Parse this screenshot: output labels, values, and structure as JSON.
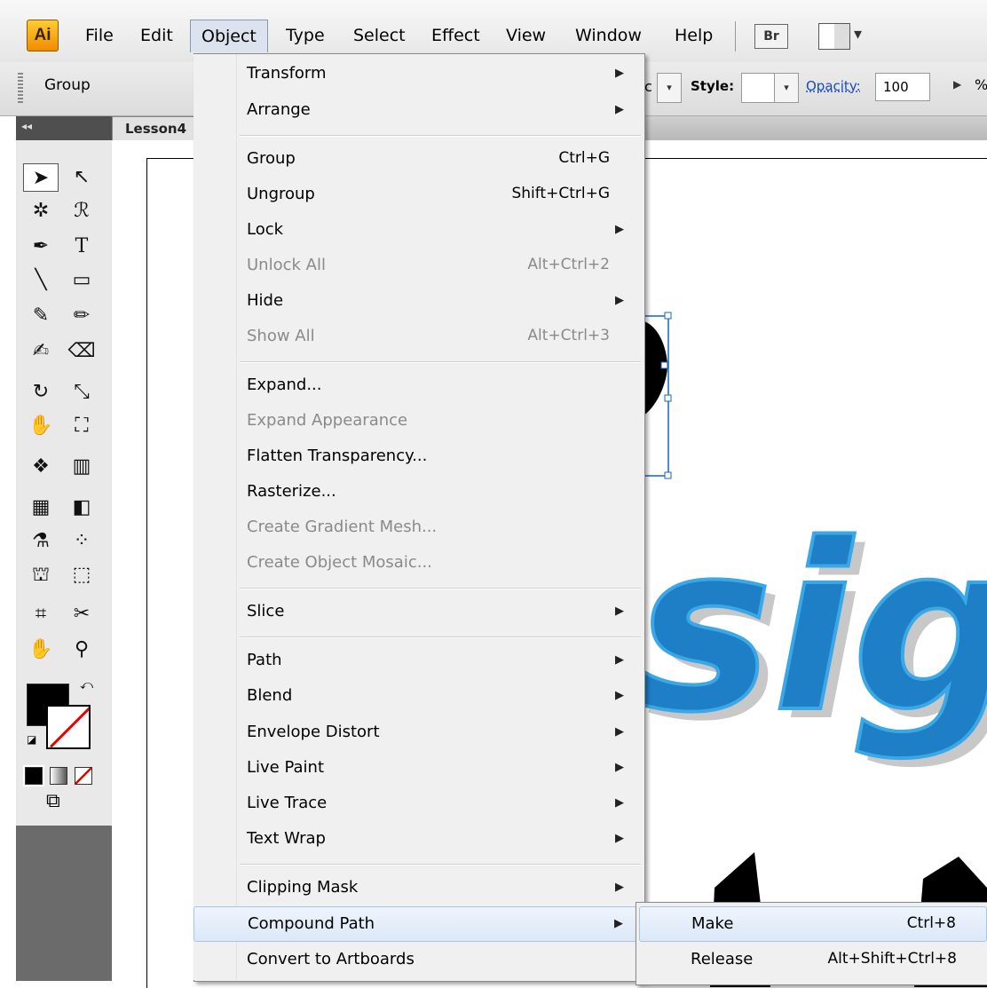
{
  "app": {
    "logo": "Ai"
  },
  "menubar": {
    "items": [
      "File",
      "Edit",
      "Object",
      "Type",
      "Select",
      "Effect",
      "View",
      "Window",
      "Help"
    ],
    "bridge_label": "Br"
  },
  "controlbar": {
    "selection_label": "Group",
    "partial_text": "c",
    "style_label": "Style:",
    "opacity_label": "Opacity:",
    "opacity_value": "100",
    "opacity_unit": "%"
  },
  "tools": {
    "collapse": "◂◂"
  },
  "document": {
    "tab_label": "Lesson4"
  },
  "object_menu": {
    "items": [
      {
        "label": "Transform",
        "shortcut": "",
        "submenu": true,
        "enabled": true
      },
      {
        "label": "Arrange",
        "shortcut": "",
        "submenu": true,
        "enabled": true
      },
      {
        "label": "Group",
        "shortcut": "Ctrl+G",
        "submenu": false,
        "enabled": true
      },
      {
        "label": "Ungroup",
        "shortcut": "Shift+Ctrl+G",
        "submenu": false,
        "enabled": true
      },
      {
        "label": "Lock",
        "shortcut": "",
        "submenu": true,
        "enabled": true
      },
      {
        "label": "Unlock All",
        "shortcut": "Alt+Ctrl+2",
        "submenu": false,
        "enabled": false
      },
      {
        "label": "Hide",
        "shortcut": "",
        "submenu": true,
        "enabled": true
      },
      {
        "label": "Show All",
        "shortcut": "Alt+Ctrl+3",
        "submenu": false,
        "enabled": false
      },
      {
        "label": "Expand...",
        "shortcut": "",
        "submenu": false,
        "enabled": true
      },
      {
        "label": "Expand Appearance",
        "shortcut": "",
        "submenu": false,
        "enabled": false
      },
      {
        "label": "Flatten Transparency...",
        "shortcut": "",
        "submenu": false,
        "enabled": true
      },
      {
        "label": "Rasterize...",
        "shortcut": "",
        "submenu": false,
        "enabled": true
      },
      {
        "label": "Create Gradient Mesh...",
        "shortcut": "",
        "submenu": false,
        "enabled": false
      },
      {
        "label": "Create Object Mosaic...",
        "shortcut": "",
        "submenu": false,
        "enabled": false
      },
      {
        "label": "Slice",
        "shortcut": "",
        "submenu": true,
        "enabled": true
      },
      {
        "label": "Path",
        "shortcut": "",
        "submenu": true,
        "enabled": true
      },
      {
        "label": "Blend",
        "shortcut": "",
        "submenu": true,
        "enabled": true
      },
      {
        "label": "Envelope Distort",
        "shortcut": "",
        "submenu": true,
        "enabled": true
      },
      {
        "label": "Live Paint",
        "shortcut": "",
        "submenu": true,
        "enabled": true
      },
      {
        "label": "Live Trace",
        "shortcut": "",
        "submenu": true,
        "enabled": true
      },
      {
        "label": "Text Wrap",
        "shortcut": "",
        "submenu": true,
        "enabled": true
      },
      {
        "label": "Clipping Mask",
        "shortcut": "",
        "submenu": true,
        "enabled": true
      },
      {
        "label": "Compound Path",
        "shortcut": "",
        "submenu": true,
        "enabled": true,
        "highlighted": true
      },
      {
        "label": "Convert to Artboards",
        "shortcut": "",
        "submenu": false,
        "enabled": true
      }
    ]
  },
  "compound_path_submenu": {
    "items": [
      {
        "label": "Make",
        "shortcut": "Ctrl+8",
        "highlighted": true
      },
      {
        "label": "Release",
        "shortcut": "Alt+Shift+Ctrl+8"
      }
    ]
  },
  "artwork": {
    "text_fragment": "sig",
    "text_color": "#1e7fc6",
    "highlight_color": "#3aa8e6",
    "shadow_color": "#c8c8c8"
  },
  "colors": {
    "menu_highlight": "#dce8f8",
    "accent": "#1a4ab8"
  }
}
